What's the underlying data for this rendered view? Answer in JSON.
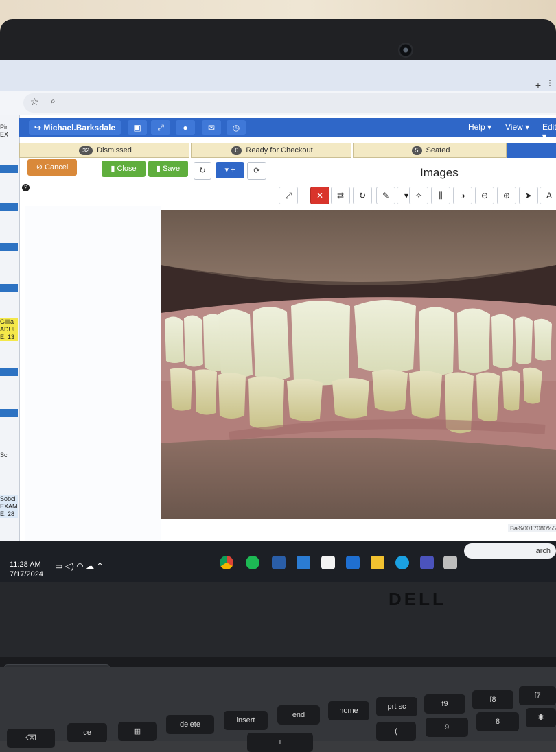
{
  "app": {
    "user": "Michael.Barksdale",
    "menu": [
      "Help",
      "View",
      "Edit"
    ]
  },
  "status_tabs": [
    {
      "label": "Dismissed",
      "count": "32"
    },
    {
      "label": "Ready for Checkout",
      "count": "0"
    },
    {
      "label": "Seated",
      "count": "5"
    }
  ],
  "buttons": {
    "cancel": "Cancel",
    "close": "Close",
    "save": "Save",
    "add": "+"
  },
  "panel": {
    "title": "Images"
  },
  "side_cards": [
    {
      "name": "Gillia",
      "line1": "ADUL",
      "line2": "E: 13"
    },
    {
      "name": "Sobcl",
      "line1": "EXAM",
      "line2": "E: 28"
    }
  ],
  "side_partial": [
    "Pir",
    "EX",
    "Sc"
  ],
  "url_fragment": "Ba%0017080%5#",
  "taskbar": {
    "search": "arch",
    "time": "11:28 AM",
    "date": "7/17/2024"
  },
  "brand": "DELL",
  "keys": {
    "delete": "delete",
    "insert": "insert",
    "end": "end",
    "home": "home",
    "prtsc": "prt sc",
    "f9": "f9",
    "f8": "f8",
    "f7": "f7",
    "num9": "9",
    "num8": "8",
    "ce": "ce"
  },
  "colors": {
    "appbar": "#2f67c8",
    "status_tab": "#f3e9c4",
    "cancel": "#d9893a",
    "save_close": "#5fae3d",
    "delete_tool": "#d9342b"
  }
}
